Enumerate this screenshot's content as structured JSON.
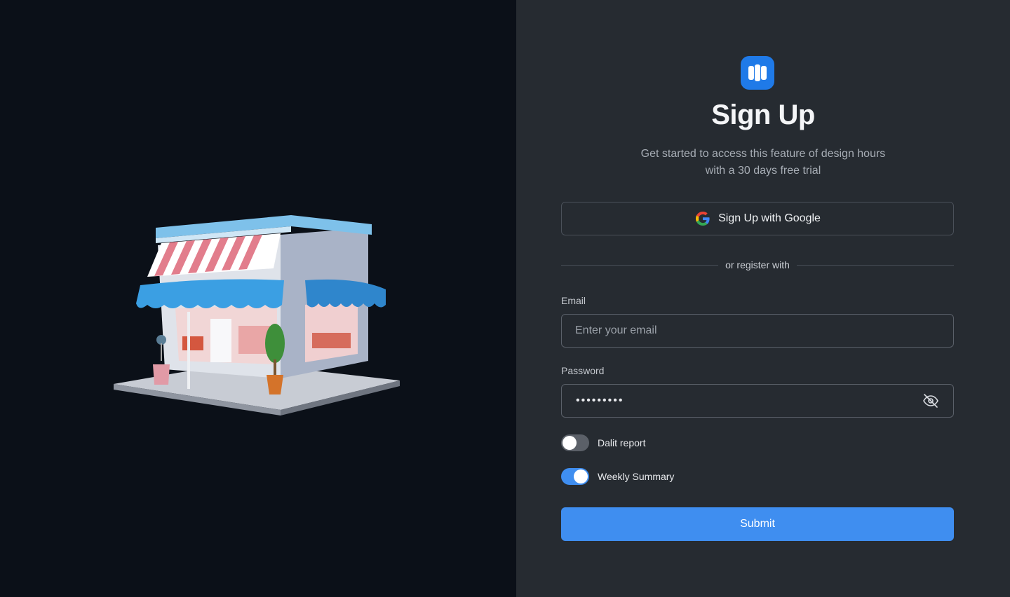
{
  "illustration": {
    "name": "storefront-illustration"
  },
  "logo": {
    "icon": "book-icon",
    "color": "#1f7ae8"
  },
  "title": "Sign Up",
  "subtitle_line1": "Get started to access this feature of design hours",
  "subtitle_line2": "with a 30 days free trial",
  "google_button": {
    "label": "Sign Up with Google",
    "icon": "google-icon"
  },
  "divider_text": "or register with",
  "email": {
    "label": "Email",
    "placeholder": "Enter your email",
    "value": ""
  },
  "password": {
    "label": "Password",
    "value": "•••••••••",
    "toggle_icon": "eye-off-icon"
  },
  "toggles": [
    {
      "label": "Dalit report",
      "enabled": false
    },
    {
      "label": "Weekly Summary",
      "enabled": true
    }
  ],
  "submit_label": "Submit",
  "colors": {
    "accent": "#3f8ef0",
    "left_bg": "#0b1018",
    "right_bg": "#262b31"
  }
}
